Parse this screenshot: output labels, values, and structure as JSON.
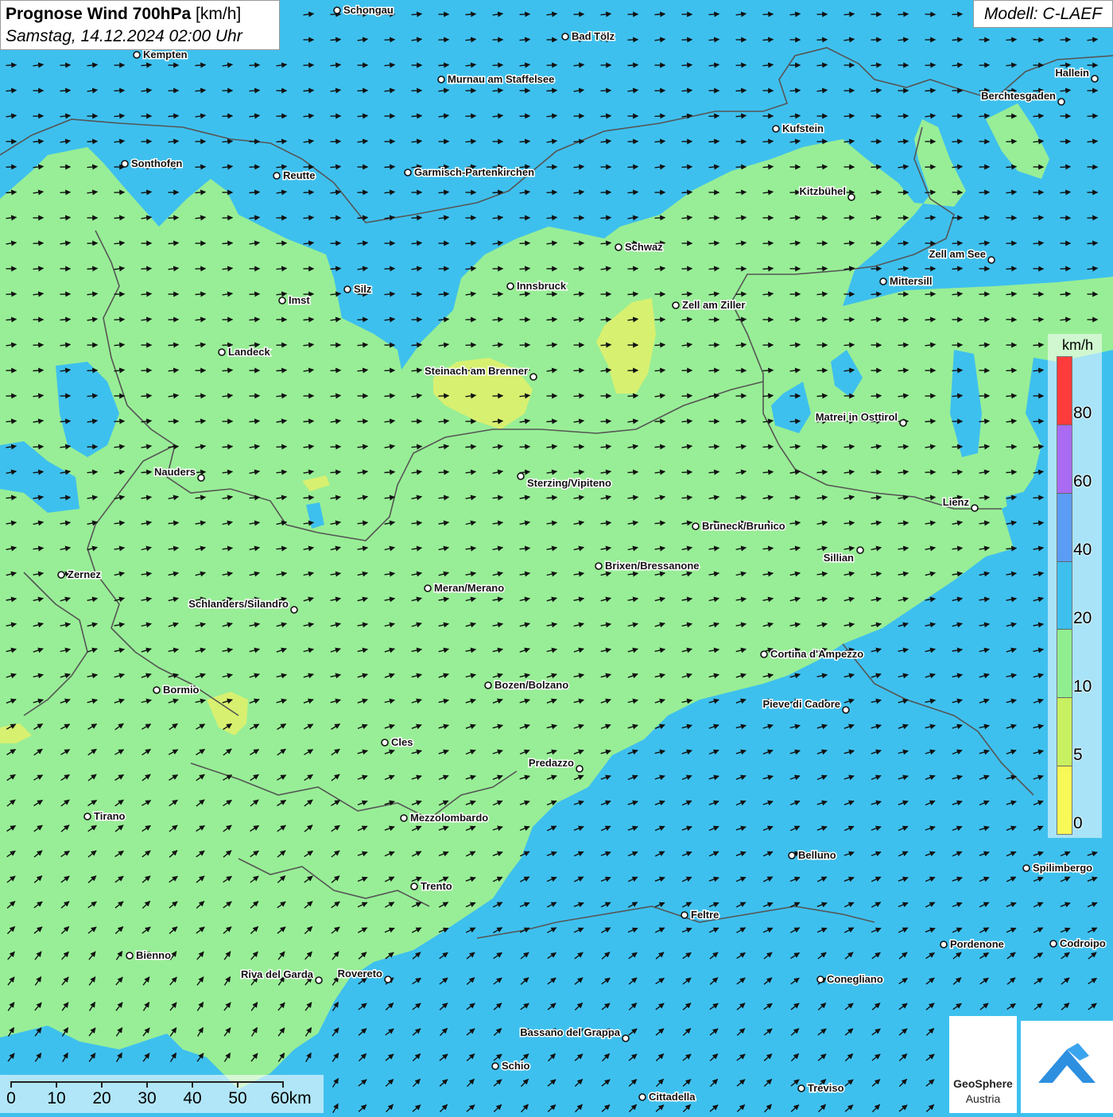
{
  "header": {
    "title": "Prognose Wind 700hPa",
    "unit": "[km/h]",
    "datetime": "Samstag, 14.12.2024 02:00 Uhr",
    "model": "Modell: C-LAEF"
  },
  "legend": {
    "unit": "km/h",
    "labels": [
      "80",
      "60",
      "40",
      "20",
      "10",
      "5",
      "0"
    ],
    "colors_top_to_bottom": [
      "#ff3b3b",
      "#a86bf2",
      "#5b9cf5",
      "#3ec0ee",
      "#90ee90",
      "#c8f060",
      "#f8f856"
    ]
  },
  "scale": {
    "labels": [
      "0",
      "10",
      "20",
      "30",
      "40",
      "50",
      "60km"
    ]
  },
  "branding": {
    "name": "GeoSphere",
    "sub": "Austria"
  },
  "colors": {
    "water_blue": "#3ec0ee",
    "land_green": "#98ee96",
    "calm_yellow": "#d8f070",
    "border": "#555555"
  },
  "cities": [
    {
      "name": "Schongau"
    },
    {
      "name": "Bad Tölz"
    },
    {
      "name": "Kempten"
    },
    {
      "name": "Murnau am Staffelsee"
    },
    {
      "name": "Hallein"
    },
    {
      "name": "Berchtesgaden"
    },
    {
      "name": "Kufstein"
    },
    {
      "name": "Sonthofen"
    },
    {
      "name": "Reutte"
    },
    {
      "name": "Garmisch-Partenkirchen"
    },
    {
      "name": "Kitzbühel"
    },
    {
      "name": "Schwaz"
    },
    {
      "name": "Zell am See"
    },
    {
      "name": "Mittersill"
    },
    {
      "name": "Silz"
    },
    {
      "name": "Innsbruck"
    },
    {
      "name": "Imst"
    },
    {
      "name": "Zell am Ziller"
    },
    {
      "name": "Landeck"
    },
    {
      "name": "Steinach am Brenner"
    },
    {
      "name": "Matrei in Osttirol"
    },
    {
      "name": "Nauders"
    },
    {
      "name": "Sterzing/Vipiteno"
    },
    {
      "name": "Lienz"
    },
    {
      "name": "Bruneck/Brunico"
    },
    {
      "name": "Sillian"
    },
    {
      "name": "Brixen/Bressanone"
    },
    {
      "name": "Zernez"
    },
    {
      "name": "Meran/Merano"
    },
    {
      "name": "Schlanders/Silandro"
    },
    {
      "name": "Cortina d'Ampezzo"
    },
    {
      "name": "Bozen/Bolzano"
    },
    {
      "name": "Bormio"
    },
    {
      "name": "Pieve di Cadore"
    },
    {
      "name": "Cles"
    },
    {
      "name": "Predazzo"
    },
    {
      "name": "Tirano"
    },
    {
      "name": "Mezzolombardo"
    },
    {
      "name": "Belluno"
    },
    {
      "name": "Spilimbergo"
    },
    {
      "name": "Trento"
    },
    {
      "name": "Feltre"
    },
    {
      "name": "Pordenone"
    },
    {
      "name": "Codroipo"
    },
    {
      "name": "Bienno"
    },
    {
      "name": "Riva del Garda"
    },
    {
      "name": "Rovereto"
    },
    {
      "name": "Conegliano"
    },
    {
      "name": "Bassano del Grappa"
    },
    {
      "name": "Schio"
    },
    {
      "name": "Treviso"
    },
    {
      "name": "Cittadella"
    }
  ]
}
